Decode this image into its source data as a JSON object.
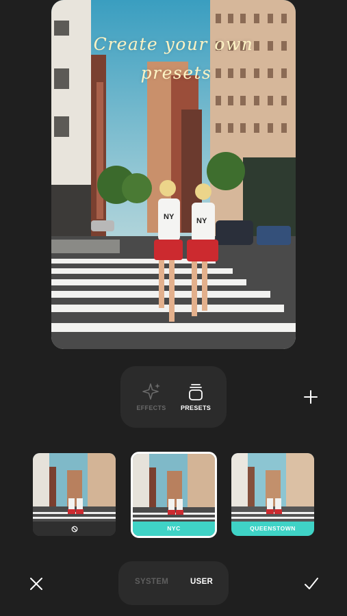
{
  "preview": {
    "headline_line1": "Create your own",
    "headline_line2": "presets"
  },
  "mode_tabs": {
    "effects_label": "EFFECTS",
    "presets_label": "PRESETS",
    "selected": "PRESETS"
  },
  "add_icon": "plus-icon",
  "presets": [
    {
      "label": "",
      "icon": "none-icon"
    },
    {
      "label": "NYC",
      "selected": true
    },
    {
      "label": "QUEENSTOWN"
    }
  ],
  "source_tabs": {
    "system_label": "SYSTEM",
    "user_label": "USER",
    "selected": "USER"
  },
  "colors": {
    "background": "#1f1f1f",
    "panel": "#2b2b2b",
    "accent": "#3fd3c6",
    "headline": "#fdf3c4"
  }
}
